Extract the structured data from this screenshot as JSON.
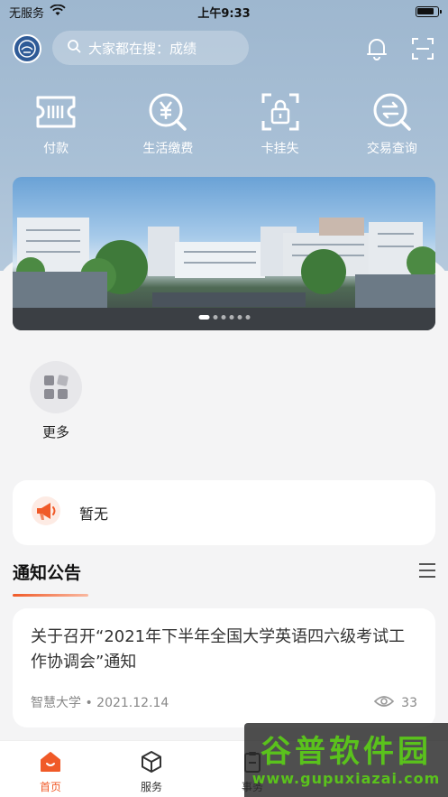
{
  "status_bar": {
    "carrier": "无服务",
    "time": "上午9:33"
  },
  "header": {
    "search_placeholder": "大家都在搜：成绩"
  },
  "quick_actions": [
    {
      "label": "付款",
      "icon": "ticket-icon"
    },
    {
      "label": "生活缴费",
      "icon": "yen-search-icon"
    },
    {
      "label": "卡挂失",
      "icon": "card-lock-icon"
    },
    {
      "label": "交易查询",
      "icon": "transfer-search-icon"
    }
  ],
  "banner": {
    "slides": 6,
    "active_slide": 0
  },
  "more": {
    "label": "更多"
  },
  "notice_bar": {
    "text": "暂无"
  },
  "announcements": {
    "title": "通知公告",
    "items": [
      {
        "title": "关于召开“2021年下半年全国大学英语四六级考试工作协调会”通知",
        "source": "智慧大学",
        "date": "2021.12.14",
        "views": "33"
      }
    ]
  },
  "tabbar": [
    {
      "label": "首页",
      "active": true
    },
    {
      "label": "服务",
      "active": false
    },
    {
      "label": "事务",
      "active": false
    }
  ],
  "watermark": {
    "main": "谷普软件园",
    "sub": "www.gupuxiazai.com"
  },
  "colors": {
    "accent": "#f05a28",
    "header_bg": "#a3bcd3",
    "page_bg": "#f4f4f5"
  }
}
